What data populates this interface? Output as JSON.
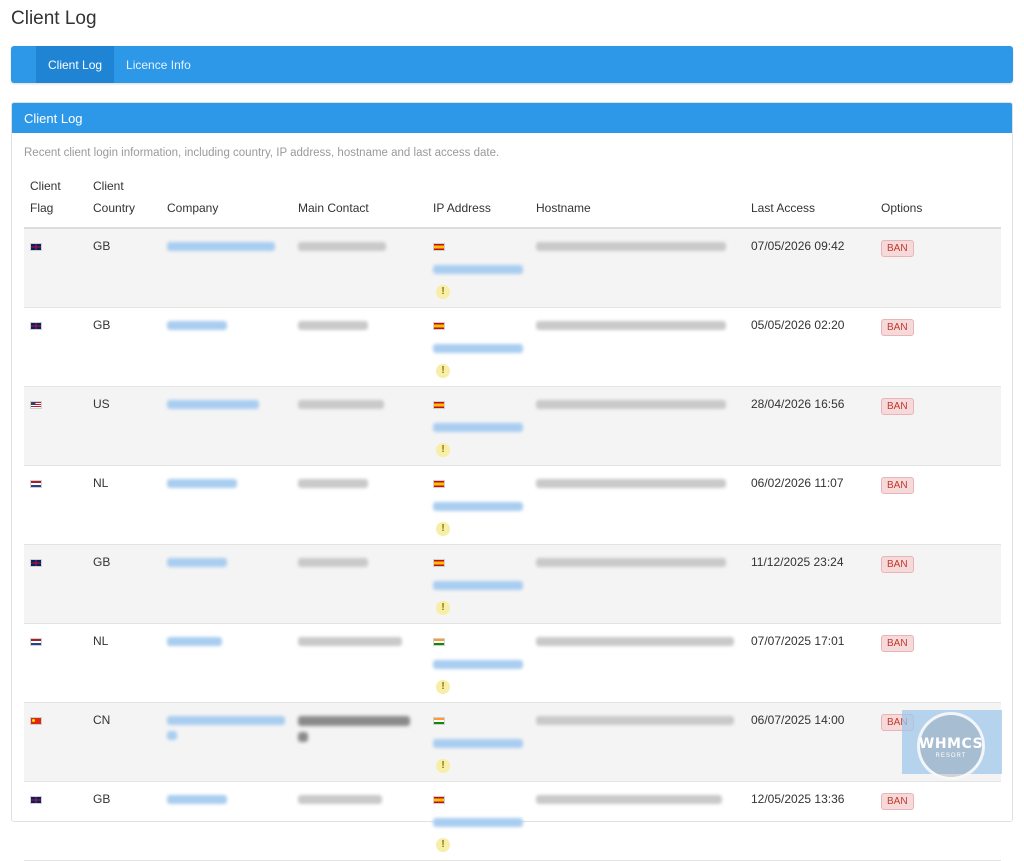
{
  "page": {
    "title": "Client Log"
  },
  "tabs": [
    {
      "label": "Client Log",
      "active": true
    },
    {
      "label": "Licence Info",
      "active": false
    }
  ],
  "panel": {
    "header": "Client Log",
    "description": "Recent client login information, including country, IP address, hostname and last access date."
  },
  "table": {
    "headers": {
      "flag": "Client Flag",
      "country": "Client Country",
      "company": "Company",
      "contact": "Main Contact",
      "ip": "IP Address",
      "hostname": "Hostname",
      "last_access": "Last Access",
      "options": "Options"
    },
    "rows": [
      {
        "flag": "gb",
        "country": "GB",
        "ip_flag": "es",
        "last_access": "07/05/2026 09:42",
        "action": "BAN"
      },
      {
        "flag": "gb",
        "country": "GB",
        "ip_flag": "es",
        "last_access": "05/05/2026 02:20",
        "action": "BAN"
      },
      {
        "flag": "us",
        "country": "US",
        "ip_flag": "es",
        "last_access": "28/04/2026 16:56",
        "action": "BAN"
      },
      {
        "flag": "nl",
        "country": "NL",
        "ip_flag": "es",
        "last_access": "06/02/2026 11:07",
        "action": "BAN"
      },
      {
        "flag": "gb",
        "country": "GB",
        "ip_flag": "es",
        "last_access": "11/12/2025 23:24",
        "action": "BAN"
      },
      {
        "flag": "nl",
        "country": "NL",
        "ip_flag": "in",
        "last_access": "07/07/2025 17:01",
        "action": "BAN"
      },
      {
        "flag": "cn",
        "country": "CN",
        "ip_flag": "in",
        "last_access": "06/07/2025 14:00",
        "action": "BAN"
      },
      {
        "flag": "gb",
        "country": "GB",
        "ip_flag": "es",
        "last_access": "12/05/2025 13:36",
        "action": "BAN"
      }
    ]
  },
  "watermark": {
    "title": "WHMCS",
    "subtitle": "RESORT"
  }
}
